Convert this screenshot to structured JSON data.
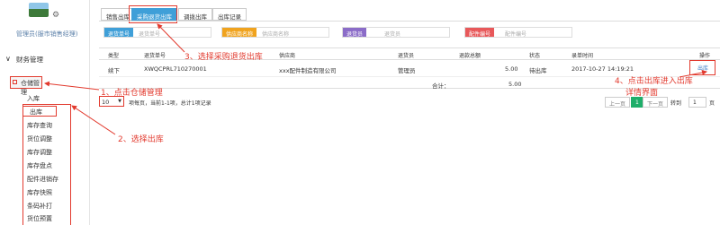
{
  "sidebar": {
    "role": "管理员(服市销售经理)",
    "finance_label": "财务管理",
    "storage_label": "仓储管理",
    "sub_items": [
      "入库",
      "出库",
      "库存查询",
      "货位调整",
      "库存调整",
      "库存盘点",
      "配件进销存",
      "库存快照",
      "条码补打",
      "货位预置"
    ]
  },
  "tabs": [
    "销售出库",
    "采购退货出库",
    "调拨出库",
    "出库记录"
  ],
  "filters": [
    {
      "label": "退货单号",
      "placeholder": "退货单号",
      "color": "#3f9fd8"
    },
    {
      "label": "供应商名称",
      "placeholder": "供应商名称",
      "color": "#f0a31e"
    },
    {
      "label": "退货员",
      "placeholder": "退货员",
      "color": "#8b6cc8"
    },
    {
      "label": "配件编号",
      "placeholder": "配件编号",
      "color": "#e8585a"
    }
  ],
  "table": {
    "headers": [
      "类型",
      "退货单号",
      "供应商",
      "退货员",
      "退款总额",
      "状态",
      "录单时间",
      "操作"
    ],
    "row": {
      "type": "续下",
      "order_no": "XWQCPRL710270001",
      "supplier": "xxx配件制造有限公司",
      "staff": "管理员",
      "amount": "5.00",
      "status": "待出库",
      "time": "2017-10-27 14:19:21",
      "action": "出库"
    },
    "total_label": "合计：",
    "total_value": "5.00"
  },
  "pager": {
    "size": "10",
    "info": "项每页，当前1-1项，总计1项记录",
    "prev": "上一页",
    "current": "1",
    "next": "下一页",
    "goto_label": "转到",
    "goto_value": "1",
    "page_word": "页"
  },
  "annotations": {
    "step1": "1、点击仓储管理",
    "step2": "2、选择出库",
    "step3": "3、选择采购退货出库",
    "step4_line1": "4、点击出库进入出库",
    "step4_line2": "详情界面"
  },
  "colors": {
    "annotation": "#e23a2e",
    "accent": "#3f9fd8",
    "pager_current": "#1fae6a"
  }
}
